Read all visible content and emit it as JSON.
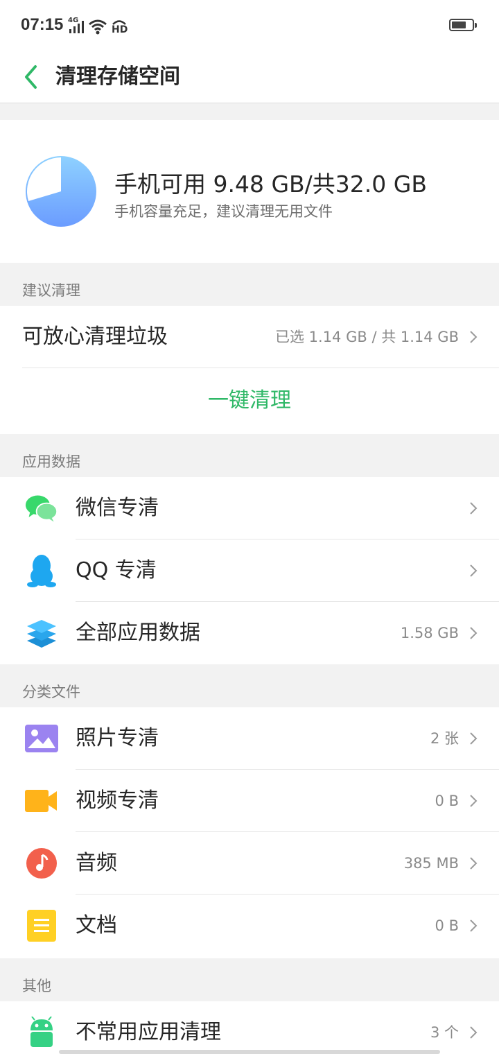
{
  "status_bar": {
    "time": "07:15",
    "network": "4G",
    "hd": "HD",
    "battery_level": 0.7
  },
  "header": {
    "back_icon": "chevron-left-icon",
    "title": "清理存储空间"
  },
  "storage": {
    "summary": "手机可用 9.48 GB/共32.0 GB",
    "hint": "手机容量充足，建议清理无用文件",
    "available_gb": 9.48,
    "total_gb": 32.0
  },
  "sections": {
    "suggested": {
      "title": "建议清理",
      "junk_label": "可放心清理垃圾",
      "junk_value": "已选 1.14 GB / 共 1.14 GB",
      "clean_button": "一键清理"
    },
    "app_data": {
      "title": "应用数据",
      "items": [
        {
          "label": "微信专清",
          "value": "",
          "icon": "wechat-icon"
        },
        {
          "label": "QQ 专清",
          "value": "",
          "icon": "qq-icon"
        },
        {
          "label": "全部应用数据",
          "value": "1.58 GB",
          "icon": "layers-icon"
        }
      ]
    },
    "files": {
      "title": "分类文件",
      "items": [
        {
          "label": "照片专清",
          "value": "2 张",
          "icon": "photo-icon"
        },
        {
          "label": "视频专清",
          "value": "0 B",
          "icon": "video-icon"
        },
        {
          "label": "音频",
          "value": "385 MB",
          "icon": "music-icon"
        },
        {
          "label": "文档",
          "value": "0 B",
          "icon": "document-icon"
        }
      ]
    },
    "other": {
      "title": "其他",
      "items": [
        {
          "label": "不常用应用清理",
          "value": "3 个",
          "icon": "android-icon"
        }
      ]
    }
  },
  "colors": {
    "accent": "#2fb867",
    "back_arrow": "#2fb867"
  }
}
